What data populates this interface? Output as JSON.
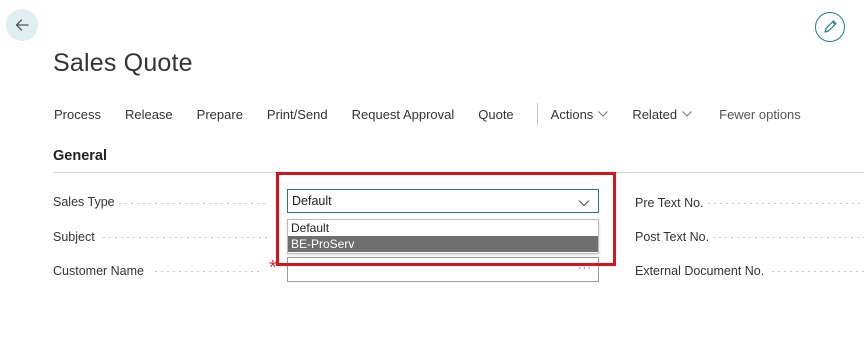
{
  "nav": {
    "back_icon": "arrow-left-icon",
    "edit_icon": "pencil-icon"
  },
  "page": {
    "title": "Sales Quote"
  },
  "actions": {
    "items": [
      "Process",
      "Release",
      "Prepare",
      "Print/Send",
      "Request Approval",
      "Quote"
    ],
    "actions_menu": "Actions",
    "related_menu": "Related",
    "fewer_options": "Fewer options"
  },
  "section": {
    "title": "General"
  },
  "fields": {
    "sales_type": {
      "label": "Sales Type",
      "value": "Default"
    },
    "subject": {
      "label": "Subject"
    },
    "customer_name": {
      "label": "Customer Name",
      "value": "",
      "lookup": "···"
    },
    "pre_text": {
      "label": "Pre Text No."
    },
    "post_text": {
      "label": "Post Text No."
    },
    "external_doc": {
      "label": "External Document No."
    }
  },
  "dropdown": {
    "options": [
      "Default",
      "BE-ProServ"
    ],
    "highlighted_index": 1
  },
  "required_marker": "*",
  "colors": {
    "accent": "#1b7f88",
    "highlight_border": "#d7141b",
    "required": "#d13438"
  }
}
